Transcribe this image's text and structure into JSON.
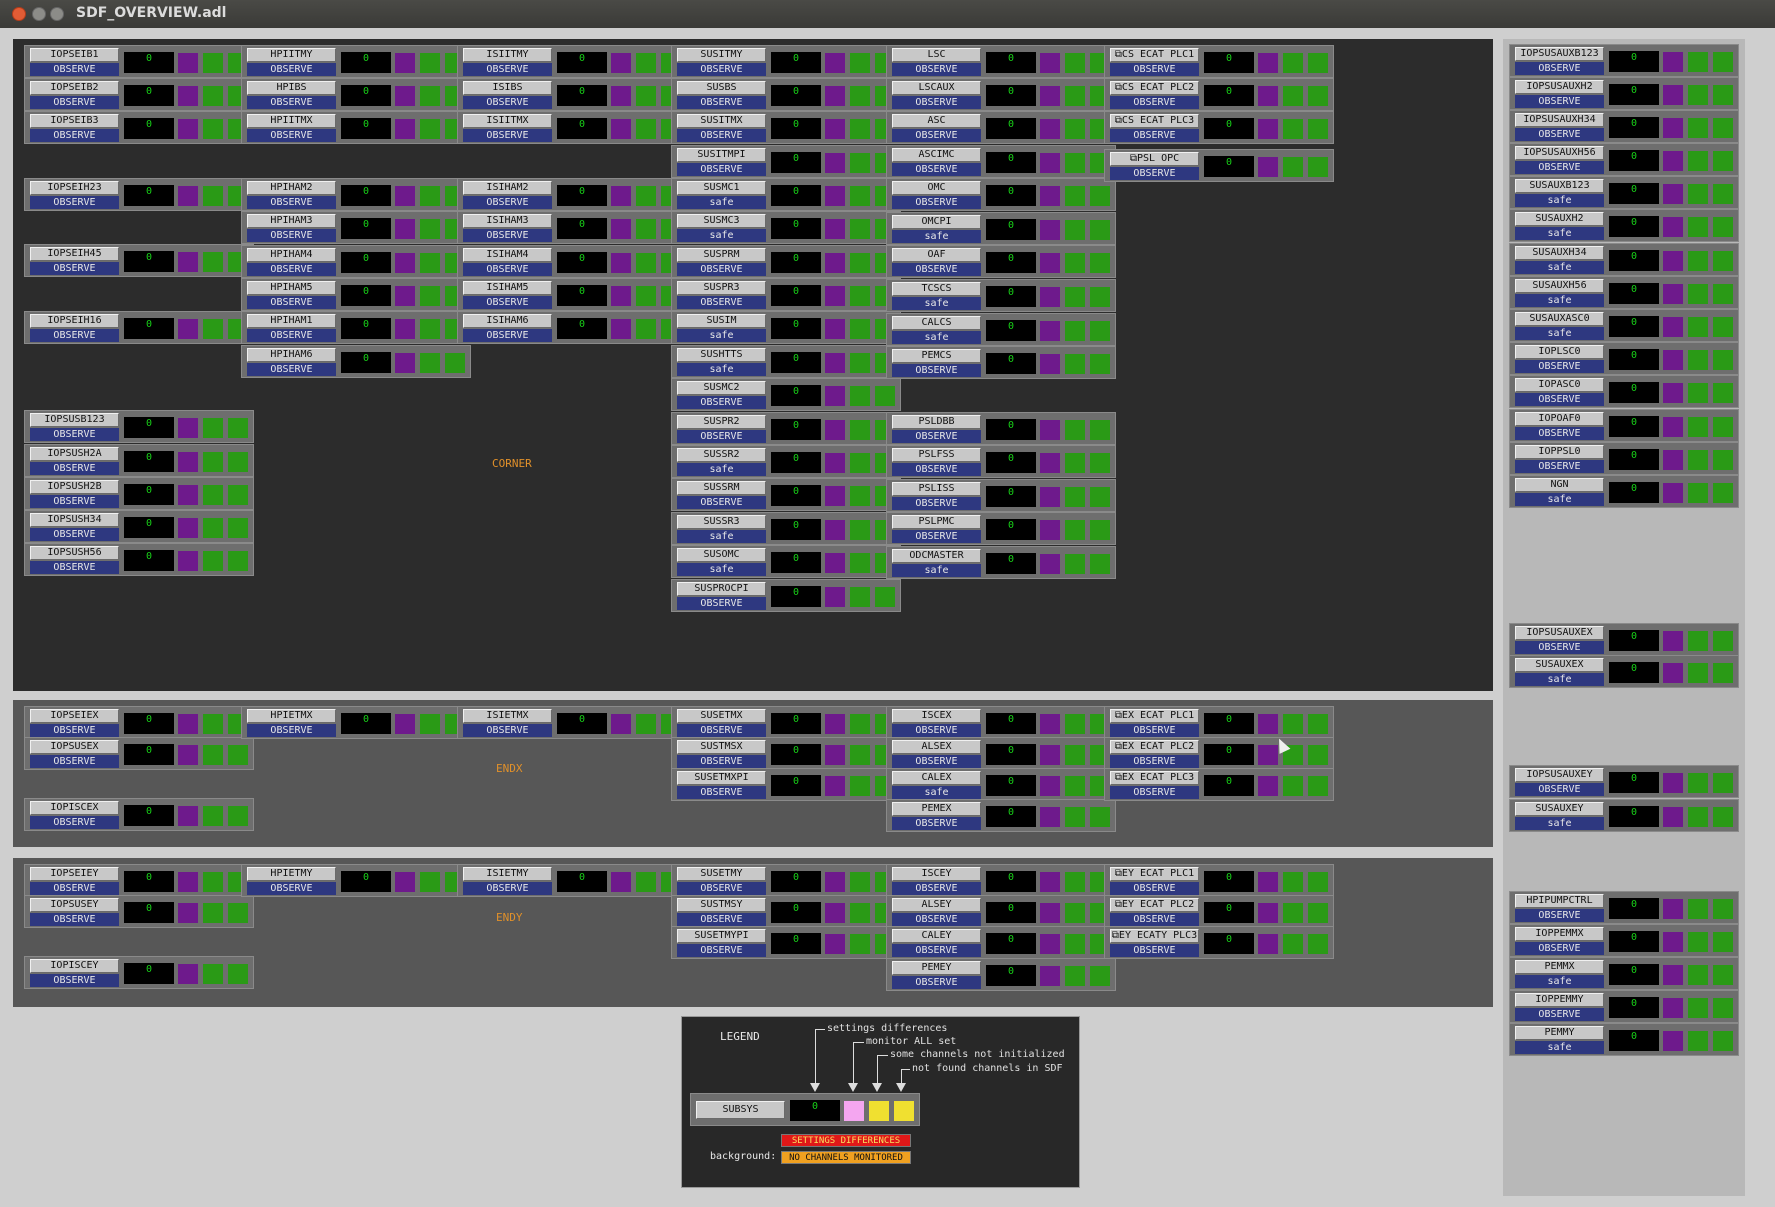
{
  "window": {
    "title": "SDF_OVERVIEW.adl"
  },
  "colors": {
    "corner_bg": "#2c2c2c",
    "end_bg": "#575757",
    "side_bg": "#b8b8b8",
    "purple": "#6e1a8c",
    "green": "#2a9a16",
    "state_blue": "#2e3880",
    "orange_label": "#e0902a"
  },
  "regions": {
    "corner": "CORNER",
    "endx": "ENDX",
    "endy": "ENDY"
  },
  "corner": {
    "col1": [
      {
        "name": "IOPSEIB1",
        "state": "OBSERVE",
        "count": "0"
      },
      {
        "name": "IOPSEIB2",
        "state": "OBSERVE",
        "count": "0"
      },
      {
        "name": "IOPSEIB3",
        "state": "OBSERVE",
        "count": "0"
      },
      {
        "name": "IOPSEIH23",
        "state": "OBSERVE",
        "count": "0"
      },
      {
        "name": "IOPSEIH45",
        "state": "OBSERVE",
        "count": "0"
      },
      {
        "name": "IOPSEIH16",
        "state": "OBSERVE",
        "count": "0"
      },
      {
        "name": "IOPSUSB123",
        "state": "OBSERVE",
        "count": "0"
      },
      {
        "name": "IOPSUSH2A",
        "state": "OBSERVE",
        "count": "0"
      },
      {
        "name": "IOPSUSH2B",
        "state": "OBSERVE",
        "count": "0"
      },
      {
        "name": "IOPSUSH34",
        "state": "OBSERVE",
        "count": "0"
      },
      {
        "name": "IOPSUSH56",
        "state": "OBSERVE",
        "count": "0"
      }
    ],
    "col2": [
      {
        "name": "HPIITMY",
        "state": "OBSERVE",
        "count": "0"
      },
      {
        "name": "HPIBS",
        "state": "OBSERVE",
        "count": "0"
      },
      {
        "name": "HPIITMX",
        "state": "OBSERVE",
        "count": "0"
      },
      {
        "name": "HPIHAM2",
        "state": "OBSERVE",
        "count": "0"
      },
      {
        "name": "HPIHAM3",
        "state": "OBSERVE",
        "count": "0"
      },
      {
        "name": "HPIHAM4",
        "state": "OBSERVE",
        "count": "0"
      },
      {
        "name": "HPIHAM5",
        "state": "OBSERVE",
        "count": "0"
      },
      {
        "name": "HPIHAM1",
        "state": "OBSERVE",
        "count": "0"
      },
      {
        "name": "HPIHAM6",
        "state": "OBSERVE",
        "count": "0"
      }
    ],
    "col3": [
      {
        "name": "ISIITMY",
        "state": "OBSERVE",
        "count": "0"
      },
      {
        "name": "ISIBS",
        "state": "OBSERVE",
        "count": "0"
      },
      {
        "name": "ISIITMX",
        "state": "OBSERVE",
        "count": "0"
      },
      {
        "name": "ISIHAM2",
        "state": "OBSERVE",
        "count": "0"
      },
      {
        "name": "ISIHAM3",
        "state": "OBSERVE",
        "count": "0"
      },
      {
        "name": "ISIHAM4",
        "state": "OBSERVE",
        "count": "0"
      },
      {
        "name": "ISIHAM5",
        "state": "OBSERVE",
        "count": "0"
      },
      {
        "name": "ISIHAM6",
        "state": "OBSERVE",
        "count": "0"
      }
    ],
    "col4": [
      {
        "name": "SUSITMY",
        "state": "OBSERVE",
        "count": "0"
      },
      {
        "name": "SUSBS",
        "state": "OBSERVE",
        "count": "0"
      },
      {
        "name": "SUSITMX",
        "state": "OBSERVE",
        "count": "0"
      },
      {
        "name": "SUSITMPI",
        "state": "OBSERVE",
        "count": "0"
      },
      {
        "name": "SUSMC1",
        "state": "safe",
        "count": "0"
      },
      {
        "name": "SUSMC3",
        "state": "safe",
        "count": "0"
      },
      {
        "name": "SUSPRM",
        "state": "OBSERVE",
        "count": "0"
      },
      {
        "name": "SUSPR3",
        "state": "OBSERVE",
        "count": "0"
      },
      {
        "name": "SUSIM",
        "state": "safe",
        "count": "0"
      },
      {
        "name": "SUSHTTS",
        "state": "safe",
        "count": "0"
      },
      {
        "name": "SUSMC2",
        "state": "OBSERVE",
        "count": "0"
      },
      {
        "name": "SUSPR2",
        "state": "OBSERVE",
        "count": "0"
      },
      {
        "name": "SUSSR2",
        "state": "safe",
        "count": "0"
      },
      {
        "name": "SUSSRM",
        "state": "OBSERVE",
        "count": "0"
      },
      {
        "name": "SUSSR3",
        "state": "safe",
        "count": "0"
      },
      {
        "name": "SUSOMC",
        "state": "safe",
        "count": "0"
      },
      {
        "name": "SUSPROCPI",
        "state": "OBSERVE",
        "count": "0"
      }
    ],
    "col5": [
      {
        "name": "LSC",
        "state": "OBSERVE",
        "count": "0"
      },
      {
        "name": "LSCAUX",
        "state": "OBSERVE",
        "count": "0"
      },
      {
        "name": "ASC",
        "state": "OBSERVE",
        "count": "0"
      },
      {
        "name": "ASCIMC",
        "state": "OBSERVE",
        "count": "0"
      },
      {
        "name": "OMC",
        "state": "OBSERVE",
        "count": "0"
      },
      {
        "name": "OMCPI",
        "state": "safe",
        "count": "0"
      },
      {
        "name": "OAF",
        "state": "OBSERVE",
        "count": "0"
      },
      {
        "name": "TCSCS",
        "state": "safe",
        "count": "0"
      },
      {
        "name": "CALCS",
        "state": "safe",
        "count": "0"
      },
      {
        "name": "PEMCS",
        "state": "OBSERVE",
        "count": "0"
      },
      {
        "name": "PSLDBB",
        "state": "OBSERVE",
        "count": "0"
      },
      {
        "name": "PSLFSS",
        "state": "OBSERVE",
        "count": "0"
      },
      {
        "name": "PSLISS",
        "state": "OBSERVE",
        "count": "0"
      },
      {
        "name": "PSLPMC",
        "state": "OBSERVE",
        "count": "0"
      },
      {
        "name": "ODCMASTER",
        "state": "safe",
        "count": "0"
      }
    ],
    "col6": [
      {
        "name": "⧉CS ECAT PLC1",
        "state": "OBSERVE",
        "count": "0"
      },
      {
        "name": "⧉CS ECAT PLC2",
        "state": "OBSERVE",
        "count": "0"
      },
      {
        "name": "⧉CS ECAT PLC3",
        "state": "OBSERVE",
        "count": "0"
      },
      {
        "name": "⧉PSL OPC",
        "state": "OBSERVE",
        "count": "0"
      }
    ]
  },
  "endx": [
    {
      "name": "IOPSEIEX",
      "state": "OBSERVE",
      "count": "0"
    },
    {
      "name": "IOPSUSEX",
      "state": "OBSERVE",
      "count": "0"
    },
    {
      "name": "IOPISCEX",
      "state": "OBSERVE",
      "count": "0"
    },
    {
      "name": "HPIETMX",
      "state": "OBSERVE",
      "count": "0"
    },
    {
      "name": "ISIETMX",
      "state": "OBSERVE",
      "count": "0"
    },
    {
      "name": "SUSETMX",
      "state": "OBSERVE",
      "count": "0"
    },
    {
      "name": "SUSTMSX",
      "state": "OBSERVE",
      "count": "0"
    },
    {
      "name": "SUSETMXPI",
      "state": "OBSERVE",
      "count": "0"
    },
    {
      "name": "ISCEX",
      "state": "OBSERVE",
      "count": "0"
    },
    {
      "name": "ALSEX",
      "state": "OBSERVE",
      "count": "0"
    },
    {
      "name": "CALEX",
      "state": "safe",
      "count": "0"
    },
    {
      "name": "PEMEX",
      "state": "OBSERVE",
      "count": "0"
    },
    {
      "name": "⧉EX ECAT PLC1",
      "state": "OBSERVE",
      "count": "0"
    },
    {
      "name": "⧉EX ECAT PLC2",
      "state": "OBSERVE",
      "count": "0"
    },
    {
      "name": "⧉EX ECAT PLC3",
      "state": "OBSERVE",
      "count": "0"
    }
  ],
  "endy": [
    {
      "name": "IOPSEIEY",
      "state": "OBSERVE",
      "count": "0"
    },
    {
      "name": "IOPSUSEY",
      "state": "OBSERVE",
      "count": "0"
    },
    {
      "name": "IOPISCEY",
      "state": "OBSERVE",
      "count": "0"
    },
    {
      "name": "HPIETMY",
      "state": "OBSERVE",
      "count": "0"
    },
    {
      "name": "ISIETMY",
      "state": "OBSERVE",
      "count": "0"
    },
    {
      "name": "SUSETMY",
      "state": "OBSERVE",
      "count": "0"
    },
    {
      "name": "SUSTMSY",
      "state": "OBSERVE",
      "count": "0"
    },
    {
      "name": "SUSETMYPI",
      "state": "OBSERVE",
      "count": "0"
    },
    {
      "name": "ISCEY",
      "state": "OBSERVE",
      "count": "0"
    },
    {
      "name": "ALSEY",
      "state": "OBSERVE",
      "count": "0"
    },
    {
      "name": "CALEY",
      "state": "OBSERVE",
      "count": "0"
    },
    {
      "name": "PEMEY",
      "state": "OBSERVE",
      "count": "0"
    },
    {
      "name": "⧉EY ECAT PLC1",
      "state": "OBSERVE",
      "count": "0"
    },
    {
      "name": "⧉EY ECAT PLC2",
      "state": "OBSERVE",
      "count": "0"
    },
    {
      "name": "⧉EY ECATY PLC3",
      "state": "OBSERVE",
      "count": "0"
    }
  ],
  "side": [
    {
      "name": "IOPSUSAUXB123",
      "state": "OBSERVE",
      "count": "0"
    },
    {
      "name": "IOPSUSAUXH2",
      "state": "OBSERVE",
      "count": "0"
    },
    {
      "name": "IOPSUSAUXH34",
      "state": "OBSERVE",
      "count": "0"
    },
    {
      "name": "IOPSUSAUXH56",
      "state": "OBSERVE",
      "count": "0"
    },
    {
      "name": "SUSAUXB123",
      "state": "safe",
      "count": "0"
    },
    {
      "name": "SUSAUXH2",
      "state": "safe",
      "count": "0"
    },
    {
      "name": "SUSAUXH34",
      "state": "safe",
      "count": "0"
    },
    {
      "name": "SUSAUXH56",
      "state": "safe",
      "count": "0"
    },
    {
      "name": "SUSAUXASC0",
      "state": "safe",
      "count": "0"
    },
    {
      "name": "IOPLSC0",
      "state": "OBSERVE",
      "count": "0"
    },
    {
      "name": "IOPASC0",
      "state": "OBSERVE",
      "count": "0"
    },
    {
      "name": "IOPOAF0",
      "state": "OBSERVE",
      "count": "0"
    },
    {
      "name": "IOPPSL0",
      "state": "OBSERVE",
      "count": "0"
    },
    {
      "name": "NGN",
      "state": "safe",
      "count": "0"
    },
    {
      "name": "IOPSUSAUXEX",
      "state": "OBSERVE",
      "count": "0"
    },
    {
      "name": "SUSAUXEX",
      "state": "safe",
      "count": "0"
    },
    {
      "name": "IOPSUSAUXEY",
      "state": "OBSERVE",
      "count": "0"
    },
    {
      "name": "SUSAUXEY",
      "state": "safe",
      "count": "0"
    },
    {
      "name": "HPIPUMPCTRL",
      "state": "OBSERVE",
      "count": "0"
    },
    {
      "name": "IOPPEMMX",
      "state": "OBSERVE",
      "count": "0"
    },
    {
      "name": "PEMMX",
      "state": "safe",
      "count": "0"
    },
    {
      "name": "IOPPEMMY",
      "state": "OBSERVE",
      "count": "0"
    },
    {
      "name": "PEMMY",
      "state": "safe",
      "count": "0"
    }
  ],
  "legend": {
    "title": "LEGEND",
    "notes": [
      "settings differences",
      "monitor ALL set",
      "some channels not initialized",
      "not found channels in SDF"
    ],
    "sample_name": "SUBSYS",
    "sample_count": "0",
    "sample_colors": [
      "#f4a6f0",
      "#f0e030",
      "#f0e030"
    ],
    "background_label": "background:",
    "tag1": "SETTINGS DIFFERENCES",
    "tag1_color": "#e01818",
    "tag2": "NO CHANNELS MONITORED",
    "tag2_color": "#f0a020"
  }
}
